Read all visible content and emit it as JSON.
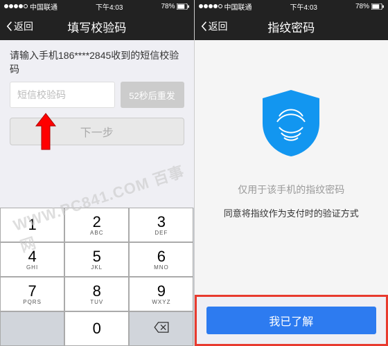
{
  "status": {
    "carrier": "中国联通",
    "time": "下午4:03",
    "battery_pct": "78%"
  },
  "left": {
    "back_label": "返回",
    "title": "填写校验码",
    "prompt": "请输入手机186****2845收到的短信校验码",
    "code_placeholder": "短信校验码",
    "resend_label": "52秒后重发",
    "next_label": "下一步"
  },
  "right": {
    "back_label": "返回",
    "title": "指纹密码",
    "line1": "仅用于该手机的指纹密码",
    "line2": "同意将指纹作为支付时的验证方式",
    "cta_label": "我已了解"
  },
  "keypad": [
    {
      "d": "1",
      "l": ""
    },
    {
      "d": "2",
      "l": "ABC"
    },
    {
      "d": "3",
      "l": "DEF"
    },
    {
      "d": "4",
      "l": "GHI"
    },
    {
      "d": "5",
      "l": "JKL"
    },
    {
      "d": "6",
      "l": "MNO"
    },
    {
      "d": "7",
      "l": "PQRS"
    },
    {
      "d": "8",
      "l": "TUV"
    },
    {
      "d": "9",
      "l": "WXYZ"
    },
    {
      "d": "",
      "l": "",
      "blank": true
    },
    {
      "d": "0",
      "l": ""
    },
    {
      "d": "",
      "l": "",
      "bs": true
    }
  ],
  "watermark": "WWW.PC841.COM 百事网"
}
